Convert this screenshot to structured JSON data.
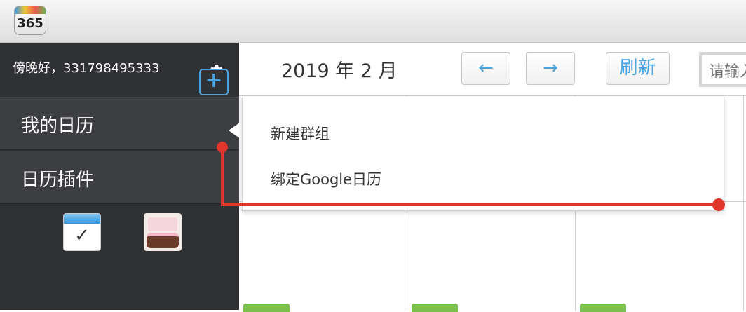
{
  "app": {
    "logo_text": "365"
  },
  "sidebar": {
    "greeting": "傍晚好，331798495333",
    "items": [
      {
        "label": "我的日历"
      },
      {
        "label": "日历插件"
      }
    ],
    "add_button_label": "+",
    "plugins": [
      {
        "name": "todo-plugin-icon"
      },
      {
        "name": "birthday-plugin-icon"
      }
    ]
  },
  "header": {
    "date_title": "2019 年 2 月",
    "prev_label": "←",
    "next_label": "→",
    "refresh_label": "刷新",
    "search_placeholder": "请输入"
  },
  "dropdown": {
    "items": [
      {
        "label": "新建群组"
      },
      {
        "label": "绑定Google日历"
      }
    ]
  },
  "colors": {
    "accent": "#4aa3df",
    "sidebar_bg": "#2f3134",
    "annotation": "#e0362c",
    "event_green": "#7bc04e"
  }
}
